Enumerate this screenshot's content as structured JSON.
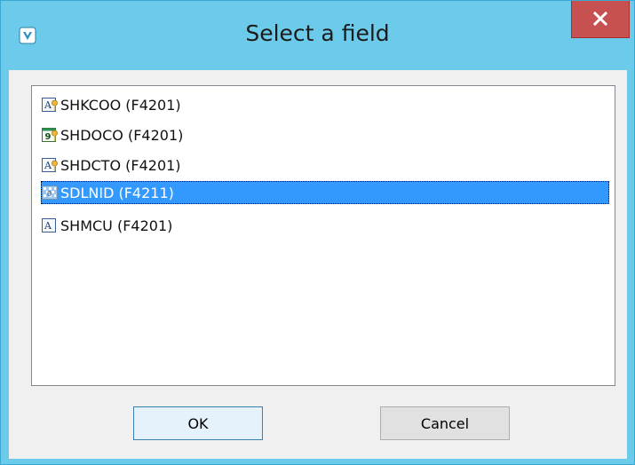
{
  "window": {
    "title": "Select a field",
    "app_icon": "app-logo-icon",
    "close_icon": "close-icon",
    "accent_color": "#6ccbea",
    "close_color": "#c75050"
  },
  "fields": [
    {
      "label": "SHKCOO (F4201)",
      "icon": "string-key-field-icon",
      "selected": false
    },
    {
      "label": "SHDOCO (F4201)",
      "icon": "numeric-key-field-icon",
      "selected": false
    },
    {
      "label": "SHDCTO (F4201)",
      "icon": "string-key-field-icon",
      "selected": false
    },
    {
      "label": "SDLNID (F4211)",
      "icon": "decimal-field-icon",
      "selected": true
    },
    {
      "label": "SHMCU (F4201)",
      "icon": "string-field-icon",
      "selected": false
    }
  ],
  "buttons": {
    "ok_label": "OK",
    "cancel_label": "Cancel"
  },
  "selection_color": "#3399ff"
}
